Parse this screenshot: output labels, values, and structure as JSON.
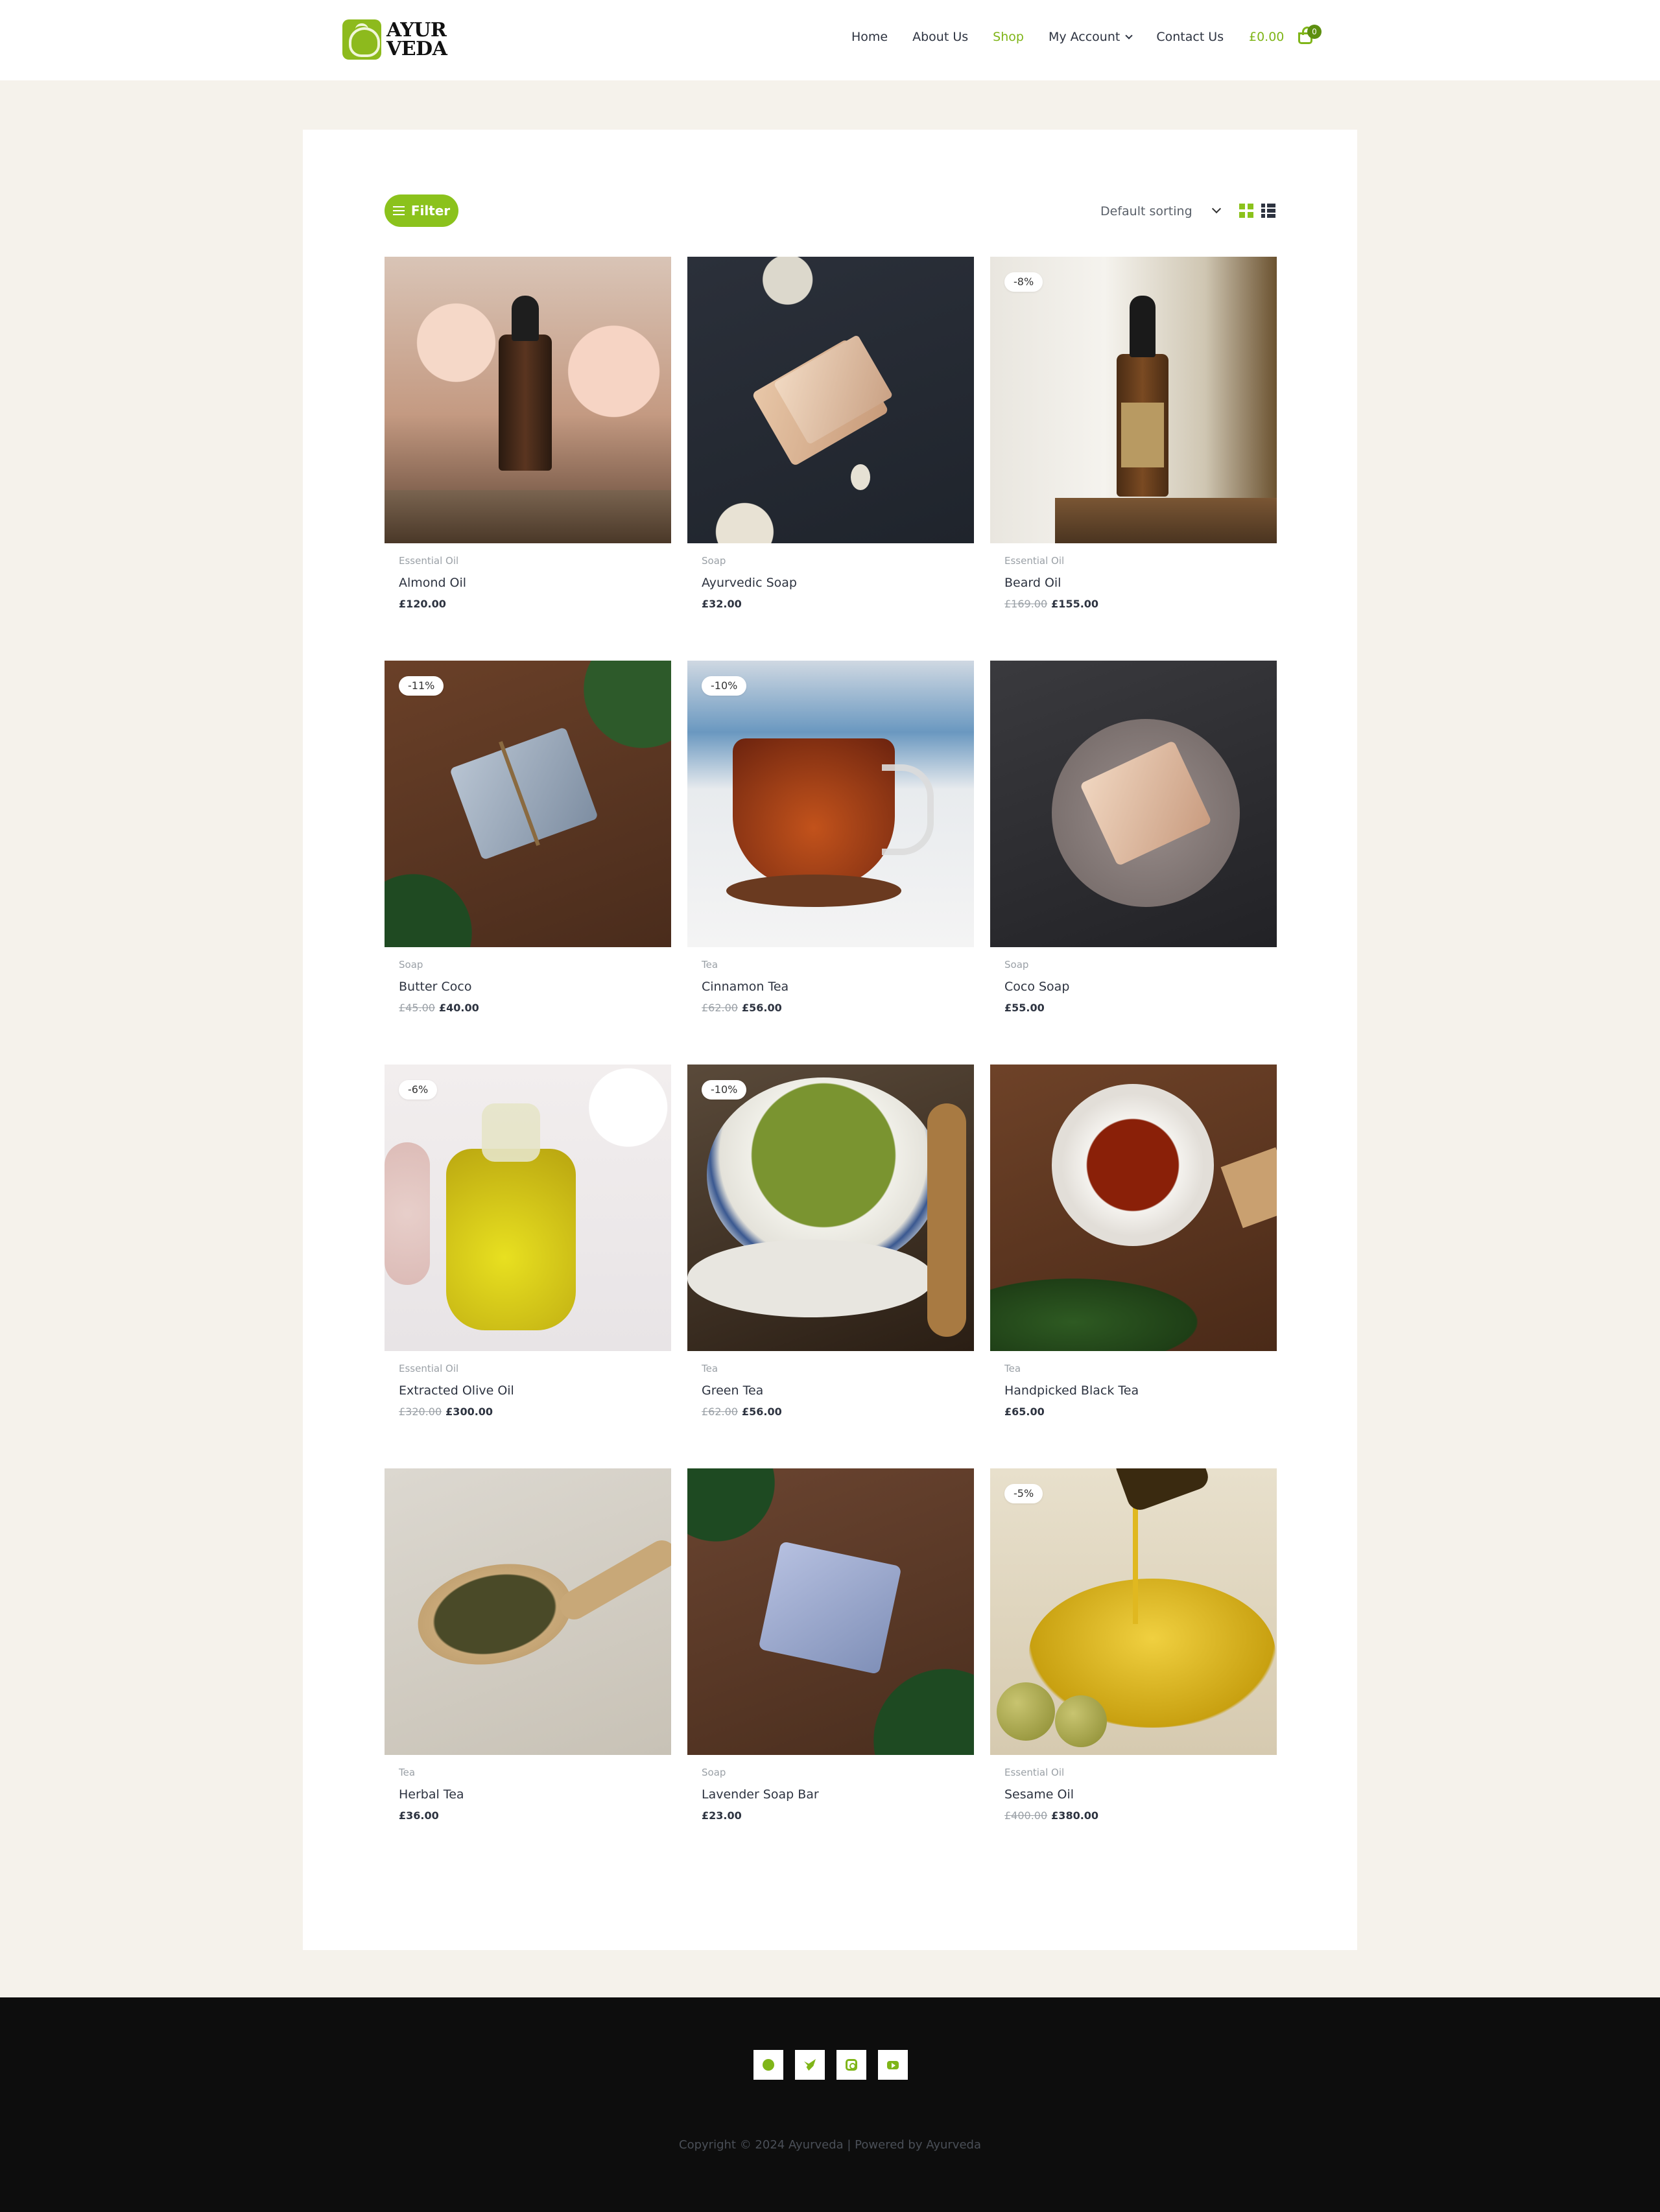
{
  "header": {
    "logo_line1": "AYUR",
    "logo_line2": "VEDA",
    "nav": [
      {
        "label": "Home"
      },
      {
        "label": "About Us"
      },
      {
        "label": "Shop"
      },
      {
        "label": "My Account"
      },
      {
        "label": "Contact Us"
      }
    ],
    "cart_total": "£0.00",
    "cart_count": "0"
  },
  "toolbar": {
    "filter_label": "Filter",
    "sorting_label": "Default sorting"
  },
  "products": [
    {
      "category": "Essential Oil",
      "name": "Almond Oil",
      "old_price": "",
      "price": "£120.00",
      "badge": ""
    },
    {
      "category": "Soap",
      "name": "Ayurvedic Soap",
      "old_price": "",
      "price": "£32.00",
      "badge": ""
    },
    {
      "category": "Essential Oil",
      "name": "Beard Oil",
      "old_price": "£169.00",
      "price": "£155.00",
      "badge": "-8%"
    },
    {
      "category": "Soap",
      "name": "Butter Coco",
      "old_price": "£45.00",
      "price": "£40.00",
      "badge": "-11%"
    },
    {
      "category": "Tea",
      "name": "Cinnamon Tea",
      "old_price": "£62.00",
      "price": "£56.00",
      "badge": "-10%"
    },
    {
      "category": "Soap",
      "name": "Coco Soap",
      "old_price": "",
      "price": "£55.00",
      "badge": ""
    },
    {
      "category": "Essential Oil",
      "name": "Extracted Olive Oil",
      "old_price": "£320.00",
      "price": "£300.00",
      "badge": "-6%"
    },
    {
      "category": "Tea",
      "name": "Green Tea",
      "old_price": "£62.00",
      "price": "£56.00",
      "badge": "-10%"
    },
    {
      "category": "Tea",
      "name": "Handpicked Black Tea",
      "old_price": "",
      "price": "£65.00",
      "badge": ""
    },
    {
      "category": "Tea",
      "name": "Herbal Tea",
      "old_price": "",
      "price": "£36.00",
      "badge": ""
    },
    {
      "category": "Soap",
      "name": "Lavender Soap Bar",
      "old_price": "",
      "price": "£23.00",
      "badge": ""
    },
    {
      "category": "Essential Oil",
      "name": "Sesame Oil",
      "old_price": "£400.00",
      "price": "£380.00",
      "badge": "-5%"
    }
  ],
  "footer": {
    "socials": [
      {
        "icon": "facebook-icon"
      },
      {
        "icon": "twitter-icon"
      },
      {
        "icon": "instagram-icon"
      },
      {
        "icon": "youtube-icon"
      }
    ],
    "copyright": "Copyright © 2024 Ayurveda | Powered by Ayurveda"
  },
  "colors": {
    "accent": "#8bc21c",
    "page_bg": "#f5f2eb",
    "footer_bg": "#0d0d0d"
  }
}
